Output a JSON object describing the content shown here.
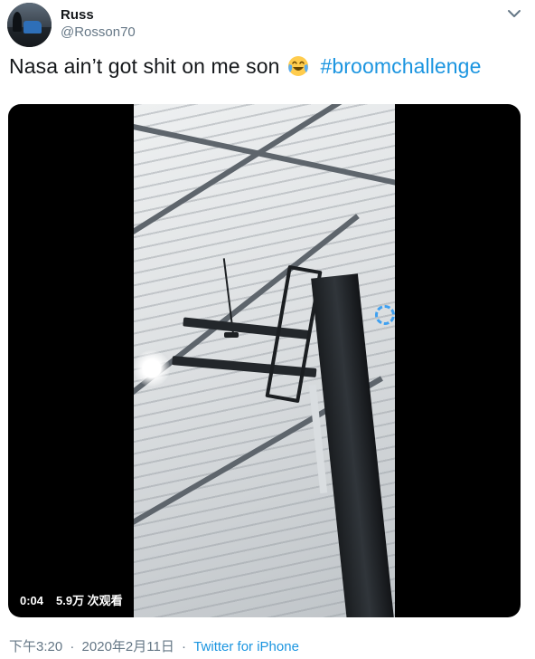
{
  "user": {
    "display_name": "Russ",
    "handle": "@Rosson70"
  },
  "tweet": {
    "text": "Nasa ain’t got shit on me son",
    "emoji_icon": "face-with-tears-of-joy-emoji",
    "hashtag": "#broomchallenge"
  },
  "media": {
    "duration": "0:04",
    "views": "5.9万 次观看"
  },
  "meta": {
    "time": "下午3:20",
    "separator": "·",
    "date": "2020年2月11日",
    "source": "Twitter for iPhone"
  },
  "colors": {
    "link": "#1b95e0",
    "secondary_text": "#657786",
    "primary_text": "#14171a"
  },
  "icons": {
    "menu": "chevron-down-icon"
  }
}
